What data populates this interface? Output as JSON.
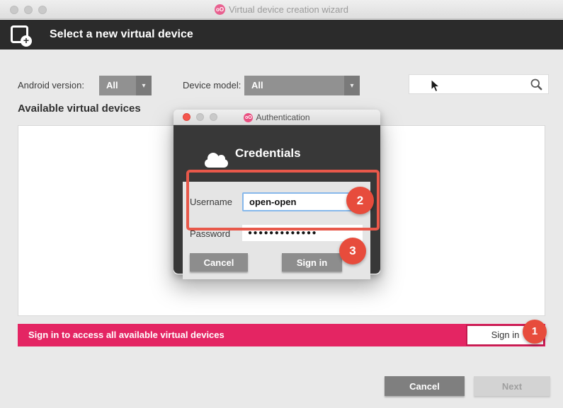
{
  "window": {
    "title": "Virtual device creation wizard",
    "header_title": "Select a new virtual device"
  },
  "filters": {
    "android_version_label": "Android version:",
    "android_version_value": "All",
    "device_model_label": "Device model:",
    "device_model_value": "All",
    "search_value": ""
  },
  "devices_section": {
    "title": "Available virtual devices"
  },
  "signin_banner": {
    "message": "Sign in to access all available virtual devices",
    "button_label": "Sign in",
    "badge": "1"
  },
  "footer": {
    "cancel_label": "Cancel",
    "next_label": "Next"
  },
  "auth_dialog": {
    "title": "Authentication",
    "heading": "Credentials",
    "username_label": "Username",
    "username_value": "open-open",
    "password_label": "Password",
    "password_value": "●●●●●●●●●●●●●",
    "cancel_label": "Cancel",
    "signin_label": "Sign in",
    "badge_form": "2",
    "badge_signin": "3"
  },
  "icons": {
    "logo_glyph": "oO",
    "plus_glyph": "+",
    "dropdown_arrow": "▾"
  },
  "colors": {
    "brand_pink": "#e42563",
    "annotation_red": "#e74c3c",
    "signin_button_border": "#c2194e",
    "header_dark": "#2b2b2b",
    "modal_dark": "#383838",
    "focus_blue": "#86b8eb"
  }
}
